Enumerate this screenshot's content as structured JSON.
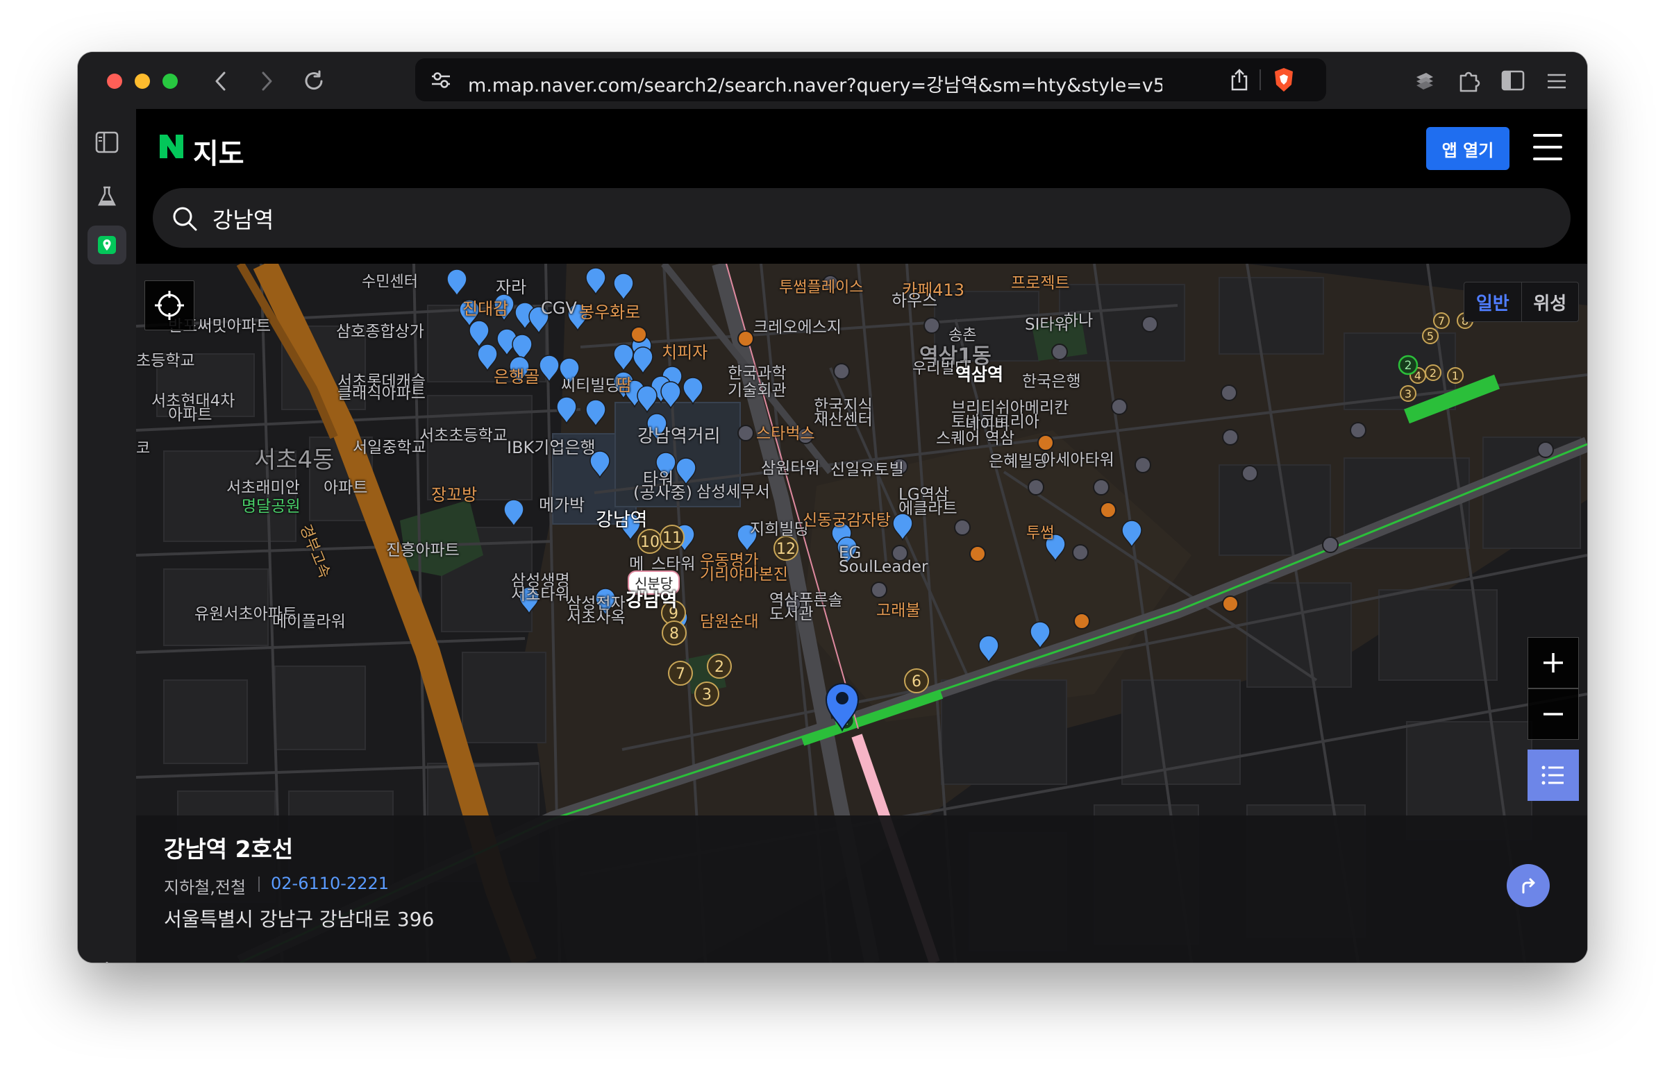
{
  "browser": {
    "url": "m.map.naver.com/search2/search.naver?query=강남역&sm=hty&style=v5..."
  },
  "header": {
    "logo_letter": "N",
    "logo_text": "지도",
    "app_button": "앱 열기"
  },
  "search": {
    "value": "강남역"
  },
  "map": {
    "type_toggle": [
      "일반",
      "위성"
    ],
    "active_type": "일반",
    "labels": [
      {
        "text": "수민센터",
        "kind": "place"
      },
      {
        "text": "자라",
        "kind": "place"
      },
      {
        "text": "카페413",
        "kind": "food"
      },
      {
        "text": "프로젝트",
        "kind": "food"
      },
      {
        "text": "투썸플레이스",
        "kind": "food"
      },
      {
        "text": "하우스",
        "kind": "place"
      },
      {
        "text": "반포써밋아파트",
        "kind": "place"
      },
      {
        "text": "진대감",
        "kind": "food"
      },
      {
        "text": "CGV",
        "kind": "place"
      },
      {
        "text": "봉우화로",
        "kind": "food"
      },
      {
        "text": "삼호종합상가",
        "kind": "place"
      },
      {
        "text": "크레오에스지",
        "kind": "place"
      },
      {
        "text": "SI타워",
        "kind": "place"
      },
      {
        "text": "하나",
        "kind": "place"
      },
      {
        "text": "송촌",
        "kind": "place"
      },
      {
        "text": "초등학교",
        "kind": "place"
      },
      {
        "text": "치피자",
        "kind": "food"
      },
      {
        "text": "역삼1동",
        "kind": "district"
      },
      {
        "text": "우리빌딩",
        "kind": "place"
      },
      {
        "text": "역삼역",
        "kind": "station"
      },
      {
        "text": "한국은행",
        "kind": "place"
      },
      {
        "text": "서초롯데캐슬",
        "kind": "place"
      },
      {
        "text": "클래식아파트",
        "kind": "place"
      },
      {
        "text": "은행골",
        "kind": "food"
      },
      {
        "text": "씨티빌딩",
        "kind": "place"
      },
      {
        "text": "땀",
        "kind": "food"
      },
      {
        "text": "한국과학",
        "kind": "place"
      },
      {
        "text": "기술회관",
        "kind": "place"
      },
      {
        "text": "서초현대4차",
        "kind": "place"
      },
      {
        "text": "아파트",
        "kind": "place"
      },
      {
        "text": "한국지식",
        "kind": "place"
      },
      {
        "text": "재산센터",
        "kind": "place"
      },
      {
        "text": "브리티쉬아메리칸",
        "kind": "place"
      },
      {
        "text": "토바코코리아",
        "kind": "place"
      },
      {
        "text": "네이버",
        "kind": "place"
      },
      {
        "text": "스퀘어 역삼",
        "kind": "place"
      },
      {
        "text": "서일중학교",
        "kind": "place"
      },
      {
        "text": "서초초등학교",
        "kind": "place"
      },
      {
        "text": "IBK기업은행",
        "kind": "place"
      },
      {
        "text": "강남역거리",
        "kind": "place"
      },
      {
        "text": "스타벅스",
        "kind": "food"
      },
      {
        "text": "은혜빌딩",
        "kind": "place"
      },
      {
        "text": "아세아타워",
        "kind": "place"
      },
      {
        "text": "서초4동",
        "kind": "district"
      },
      {
        "text": "코",
        "kind": "place"
      },
      {
        "text": "타워",
        "kind": "place"
      },
      {
        "text": "(공사중)",
        "kind": "place"
      },
      {
        "text": "삼원타워",
        "kind": "place"
      },
      {
        "text": "신일유토빌",
        "kind": "place"
      },
      {
        "text": "서초래미안",
        "kind": "place"
      },
      {
        "text": "아파트",
        "kind": "place"
      },
      {
        "text": "명달공원",
        "kind": "park"
      },
      {
        "text": "장꼬방",
        "kind": "food"
      },
      {
        "text": "메가박",
        "kind": "place"
      },
      {
        "text": "삼성세무서",
        "kind": "place"
      },
      {
        "text": "LG역삼",
        "kind": "place"
      },
      {
        "text": "에클라트",
        "kind": "place"
      },
      {
        "text": "강남역",
        "kind": "station"
      },
      {
        "text": "지희빌딩",
        "kind": "place"
      },
      {
        "text": "신동궁감자탕",
        "kind": "food"
      },
      {
        "text": "투썸",
        "kind": "food"
      },
      {
        "text": "경부고속",
        "kind": "road"
      },
      {
        "text": "진흥아파트",
        "kind": "place"
      },
      {
        "text": "EG",
        "kind": "place"
      },
      {
        "text": "SoulLeader",
        "kind": "place"
      },
      {
        "text": "우동명가",
        "kind": "food"
      },
      {
        "text": "기리야마본진",
        "kind": "food"
      },
      {
        "text": "메",
        "kind": "place"
      },
      {
        "text": "스타워",
        "kind": "place"
      },
      {
        "text": "삼성생명",
        "kind": "place"
      },
      {
        "text": "서초타워",
        "kind": "place"
      },
      {
        "text": "신분당",
        "kind": "line"
      },
      {
        "text": "강남역",
        "kind": "station"
      },
      {
        "text": "역삼푸른솔",
        "kind": "place"
      },
      {
        "text": "도서관",
        "kind": "place"
      },
      {
        "text": "고래불",
        "kind": "food"
      },
      {
        "text": "삼성전자",
        "kind": "place"
      },
      {
        "text": "서초사옥",
        "kind": "place"
      },
      {
        "text": "유원서초아파트",
        "kind": "place"
      },
      {
        "text": "메이플라워",
        "kind": "place"
      },
      {
        "text": "담원순대",
        "kind": "food"
      }
    ],
    "exit_numbers": [
      "10",
      "11",
      "12",
      "9",
      "8",
      "7",
      "2",
      "3",
      "6",
      "7",
      "8",
      "5",
      "4",
      "2",
      "1",
      "3"
    ],
    "line_numbers": [
      "2",
      "2"
    ]
  },
  "info_card": {
    "title": "강남역 2호선",
    "category": "지하철,전철",
    "phone": "02-6110-2221",
    "address": "서울특별시 강남구 강남대로 396"
  },
  "colors": {
    "accent": "#1f6ef0",
    "line2": "#2bbf3a",
    "sinbundang": "#f6b4c6",
    "pin": "#4f9bf5",
    "food_label": "#e59a52",
    "place_label": "#c7c7cc"
  }
}
